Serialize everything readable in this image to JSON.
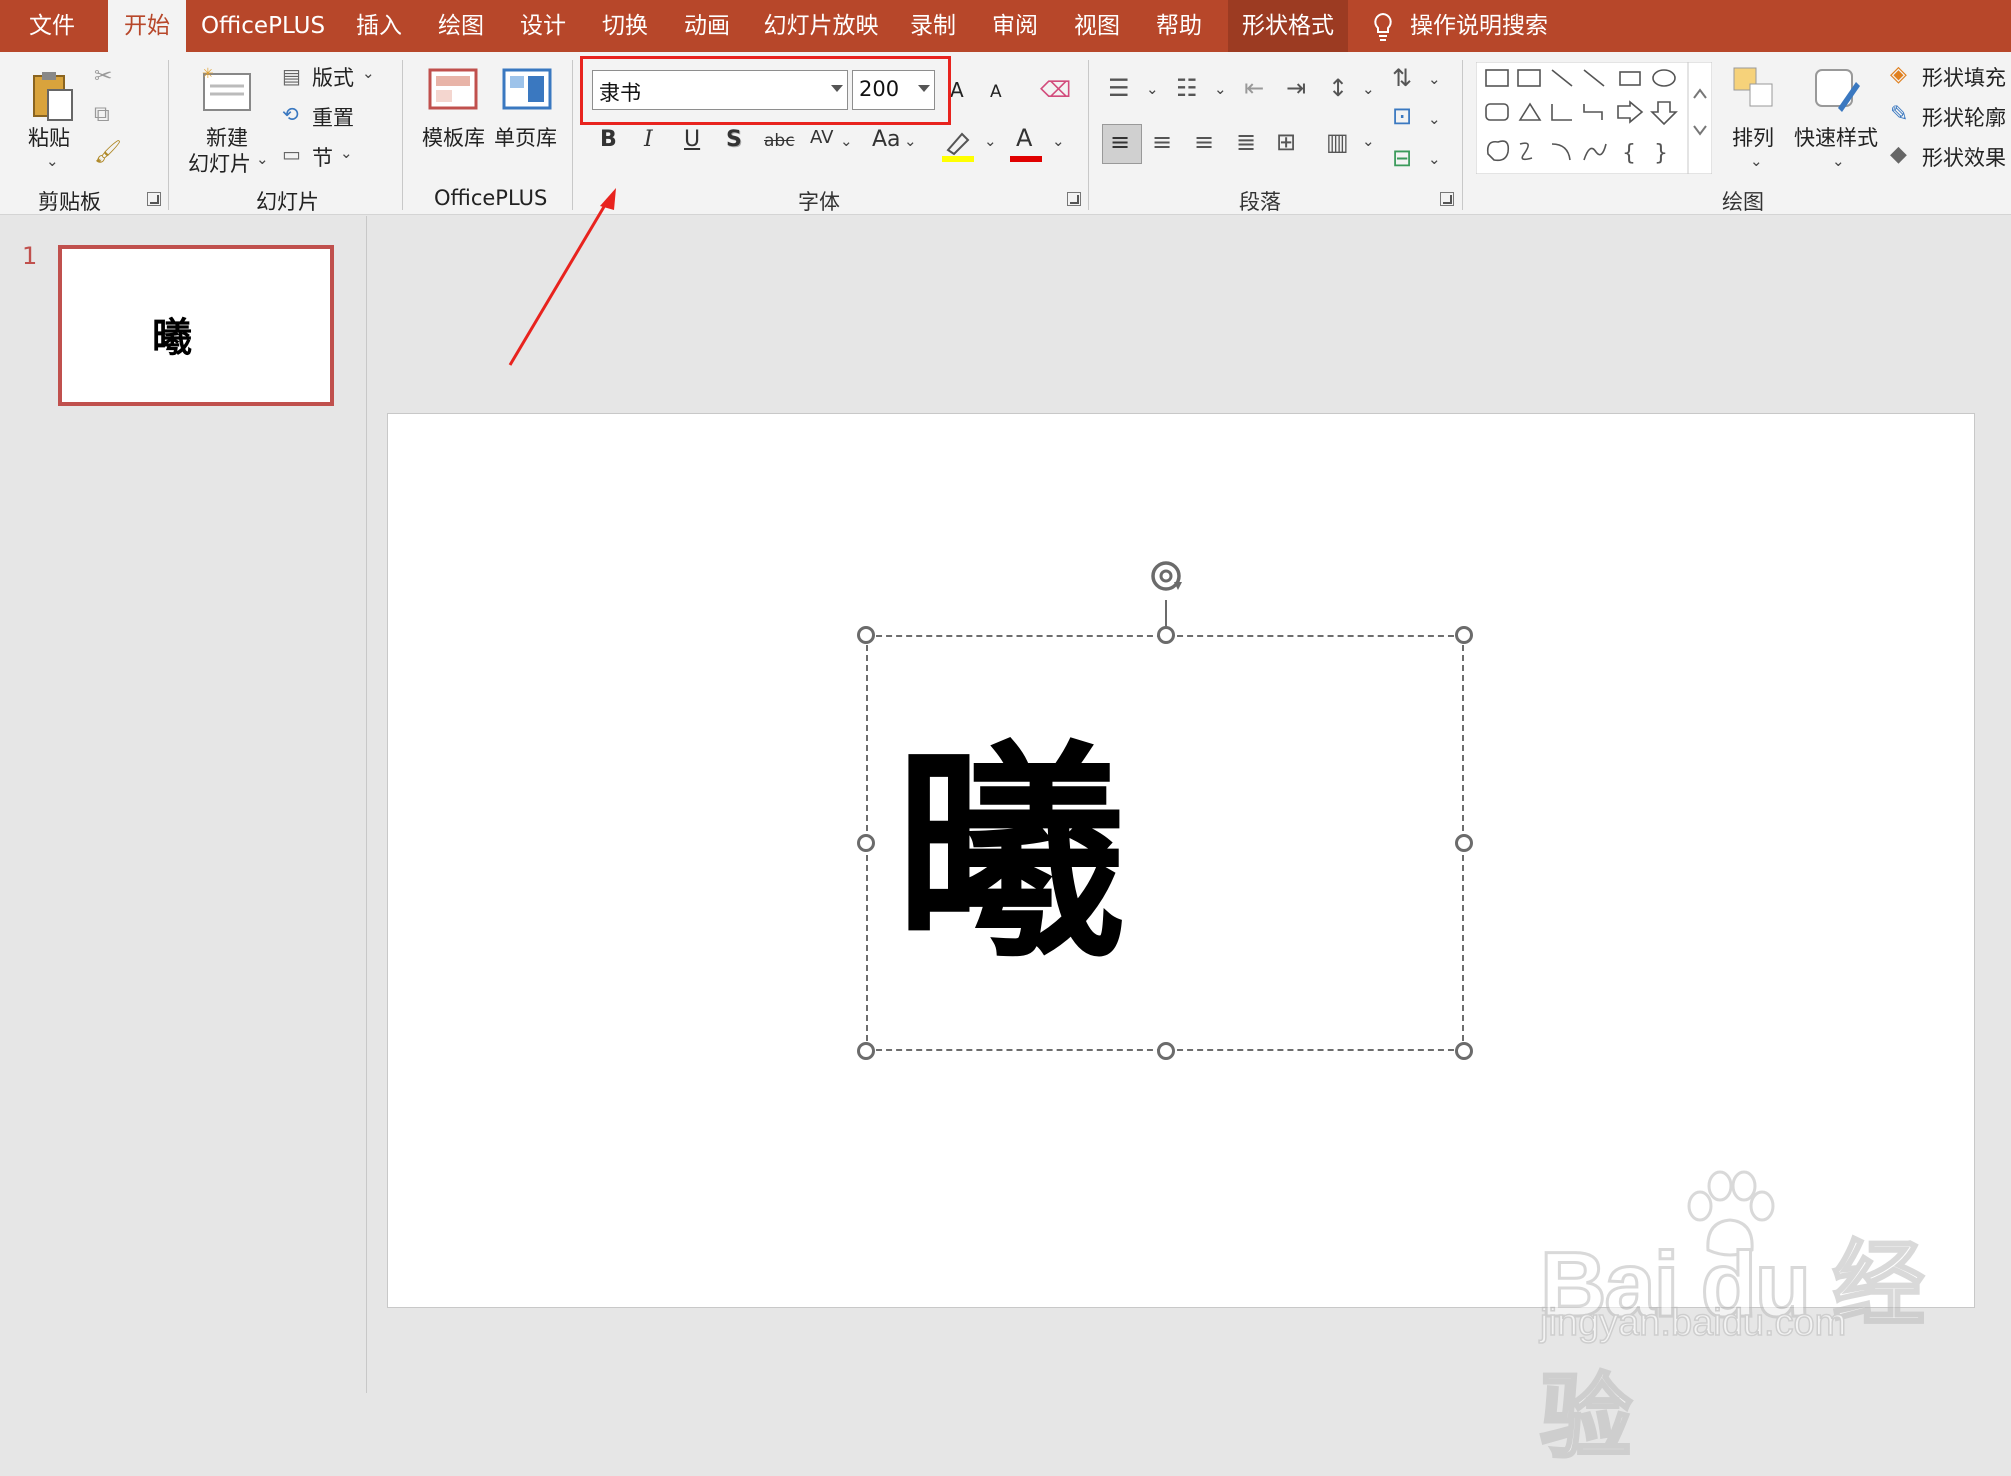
{
  "menu": {
    "tabs": [
      "文件",
      "开始",
      "OfficePLUS",
      "插入",
      "绘图",
      "设计",
      "切换",
      "动画",
      "幻灯片放映",
      "录制",
      "审阅",
      "视图",
      "帮助",
      "形状格式"
    ],
    "active_tab": "开始",
    "tell_me": "操作说明搜索"
  },
  "ribbon": {
    "clipboard": {
      "label": "剪贴板",
      "paste": "粘贴"
    },
    "slides": {
      "label": "幻灯片",
      "new_slide_line1": "新建",
      "new_slide_line2": "幻灯片",
      "layout": "版式",
      "reset": "重置",
      "section": "节"
    },
    "officeplus": {
      "label": "OfficePLUS",
      "template_lib": "模板库",
      "single_page_lib": "单页库"
    },
    "font": {
      "label": "字体",
      "font_name": "隶书",
      "font_size": "200",
      "bold": "B",
      "italic": "I",
      "underline": "U",
      "shadow": "S",
      "strike": "abc",
      "spacing": "AV",
      "case": "Aa",
      "grow": "A",
      "shrink": "A",
      "font_color_letter": "A",
      "highlight_color": "#ffff00",
      "font_color": "#e00000"
    },
    "paragraph": {
      "label": "段落"
    },
    "drawing": {
      "label": "绘图",
      "arrange": "排列",
      "quick_styles": "快速样式",
      "shape_fill": "形状填充",
      "shape_outline": "形状轮廓",
      "shape_effects": "形状效果"
    }
  },
  "slides_panel": {
    "slide_number": "1",
    "thumbnail_text": "曦"
  },
  "slide": {
    "text": "曦"
  },
  "watermark": {
    "logo": "Bai du 经验",
    "url": "jingyan.baidu.com"
  },
  "colors": {
    "accent": "#b7472a",
    "highlight_box": "#e8231e",
    "annotation_arrow": "#e8231e"
  }
}
